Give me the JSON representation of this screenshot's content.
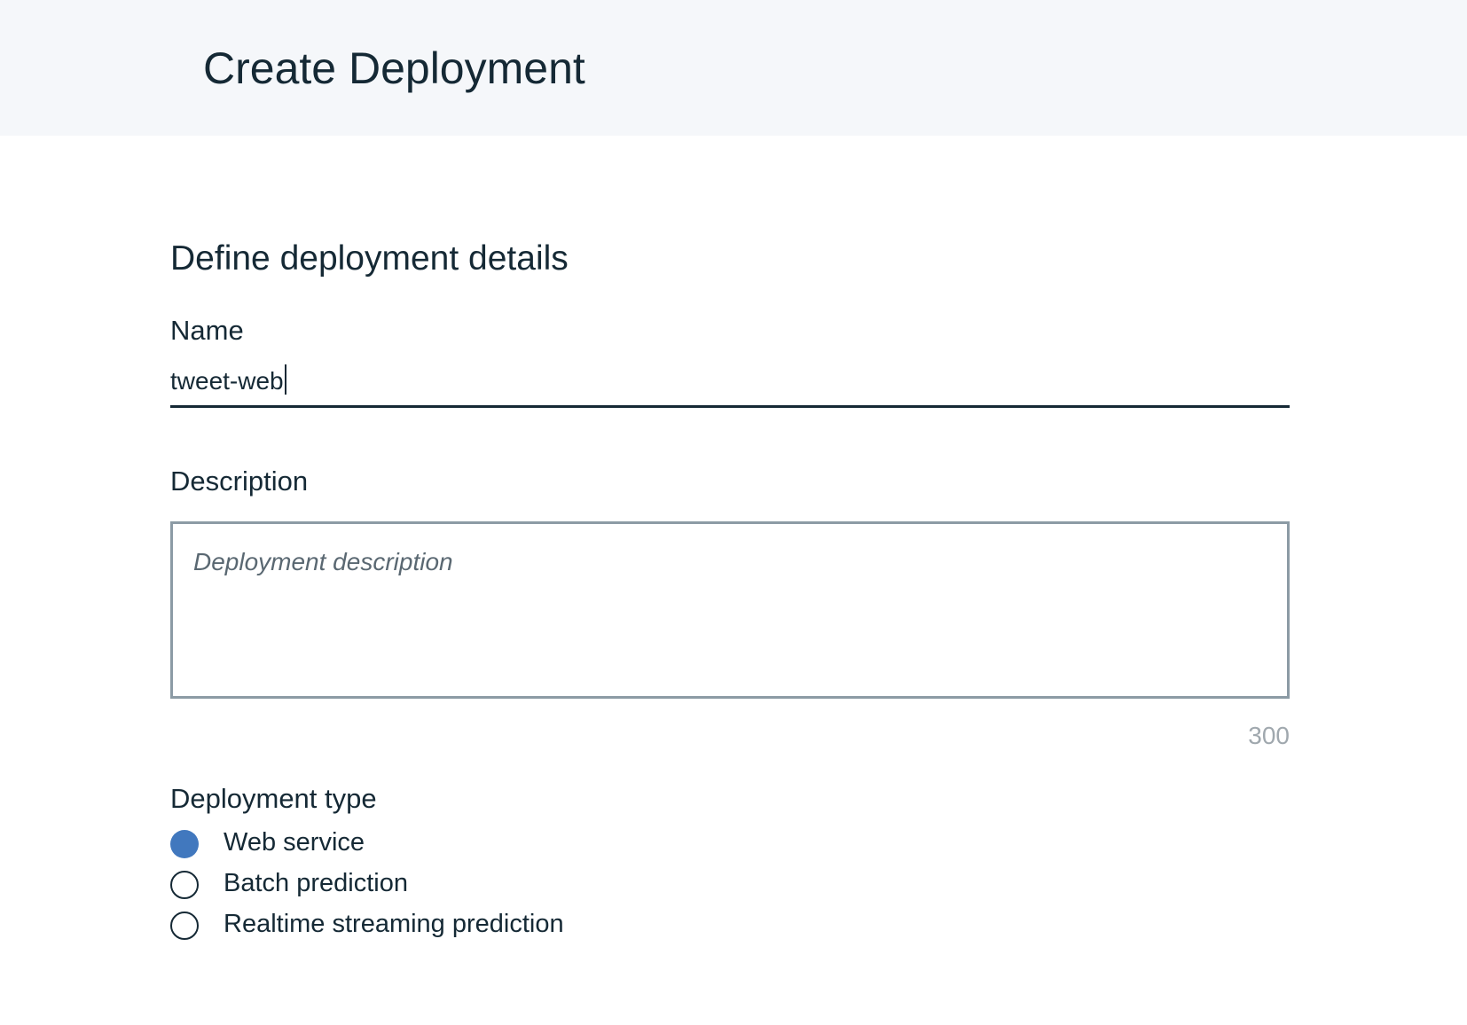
{
  "header": {
    "title": "Create Deployment"
  },
  "form": {
    "section_title": "Define deployment details",
    "name": {
      "label": "Name",
      "value": "tweet-web"
    },
    "description": {
      "label": "Description",
      "placeholder": "Deployment description",
      "char_limit": "300"
    },
    "deployment_type": {
      "label": "Deployment type",
      "selected": "Web service",
      "options": [
        {
          "label": "Web service",
          "selected": true
        },
        {
          "label": "Batch prediction",
          "selected": false
        },
        {
          "label": "Realtime streaming prediction",
          "selected": false
        }
      ]
    }
  },
  "colors": {
    "header_bg": "#f5f7fa",
    "accent": "#4178be",
    "text": "#152935",
    "border": "#8c9ba5"
  }
}
